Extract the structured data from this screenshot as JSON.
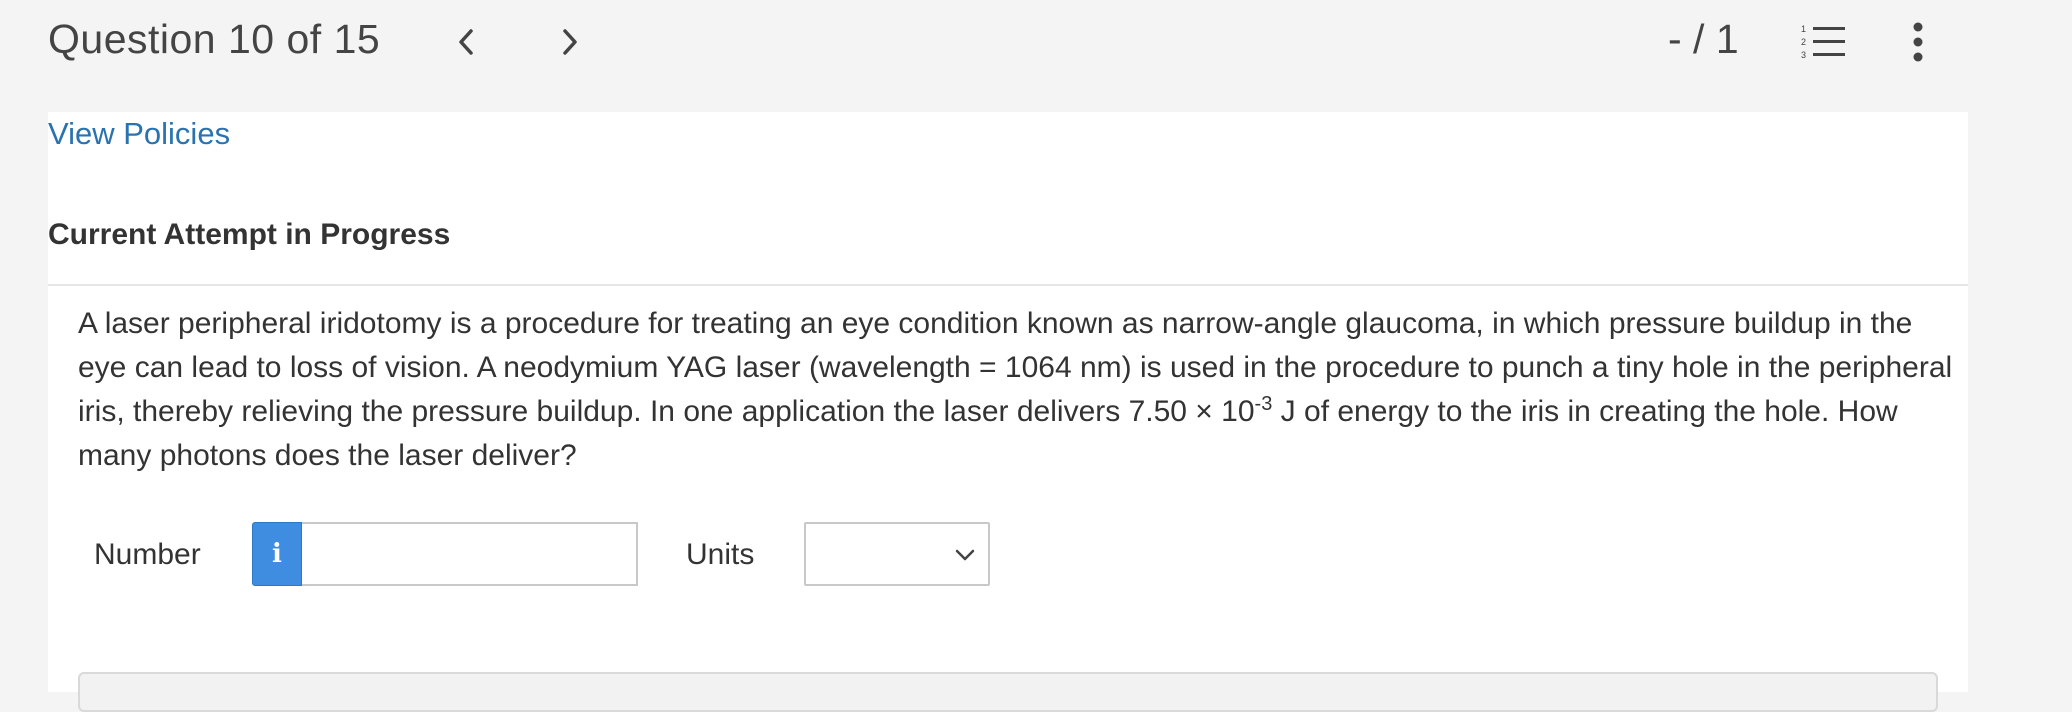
{
  "header": {
    "question_label": "Question 10 of 15",
    "score": "- / 1",
    "icons": {
      "prev": "chevron-left-icon",
      "next": "chevron-right-icon",
      "list": "numbered-list-icon",
      "more": "more-vertical-icon"
    }
  },
  "links": {
    "view_policies": "View Policies"
  },
  "section": {
    "attempt_heading": "Current Attempt in Progress"
  },
  "question": {
    "text_before_exponent": "A laser peripheral iridotomy is a procedure for treating an eye condition known as narrow-angle glaucoma, in which pressure buildup in the eye can lead to loss of vision. A neodymium YAG laser (wavelength = 1064 nm) is used in the procedure to punch a tiny hole in the peripheral iris, thereby relieving the pressure buildup. In one application the laser delivers 7.50 × 10",
    "exponent": "-3",
    "text_after_exponent": " J of energy to the iris in creating the hole. How many photons does the laser deliver?"
  },
  "answer": {
    "number_label": "Number",
    "info_icon": "info-icon",
    "info_glyph": "i",
    "number_value": "",
    "units_label": "Units",
    "units_selected": ""
  },
  "colors": {
    "link": "#2a73b0",
    "info_button": "#3f8de0",
    "background": "#f4f4f4",
    "panel": "#ffffff"
  }
}
